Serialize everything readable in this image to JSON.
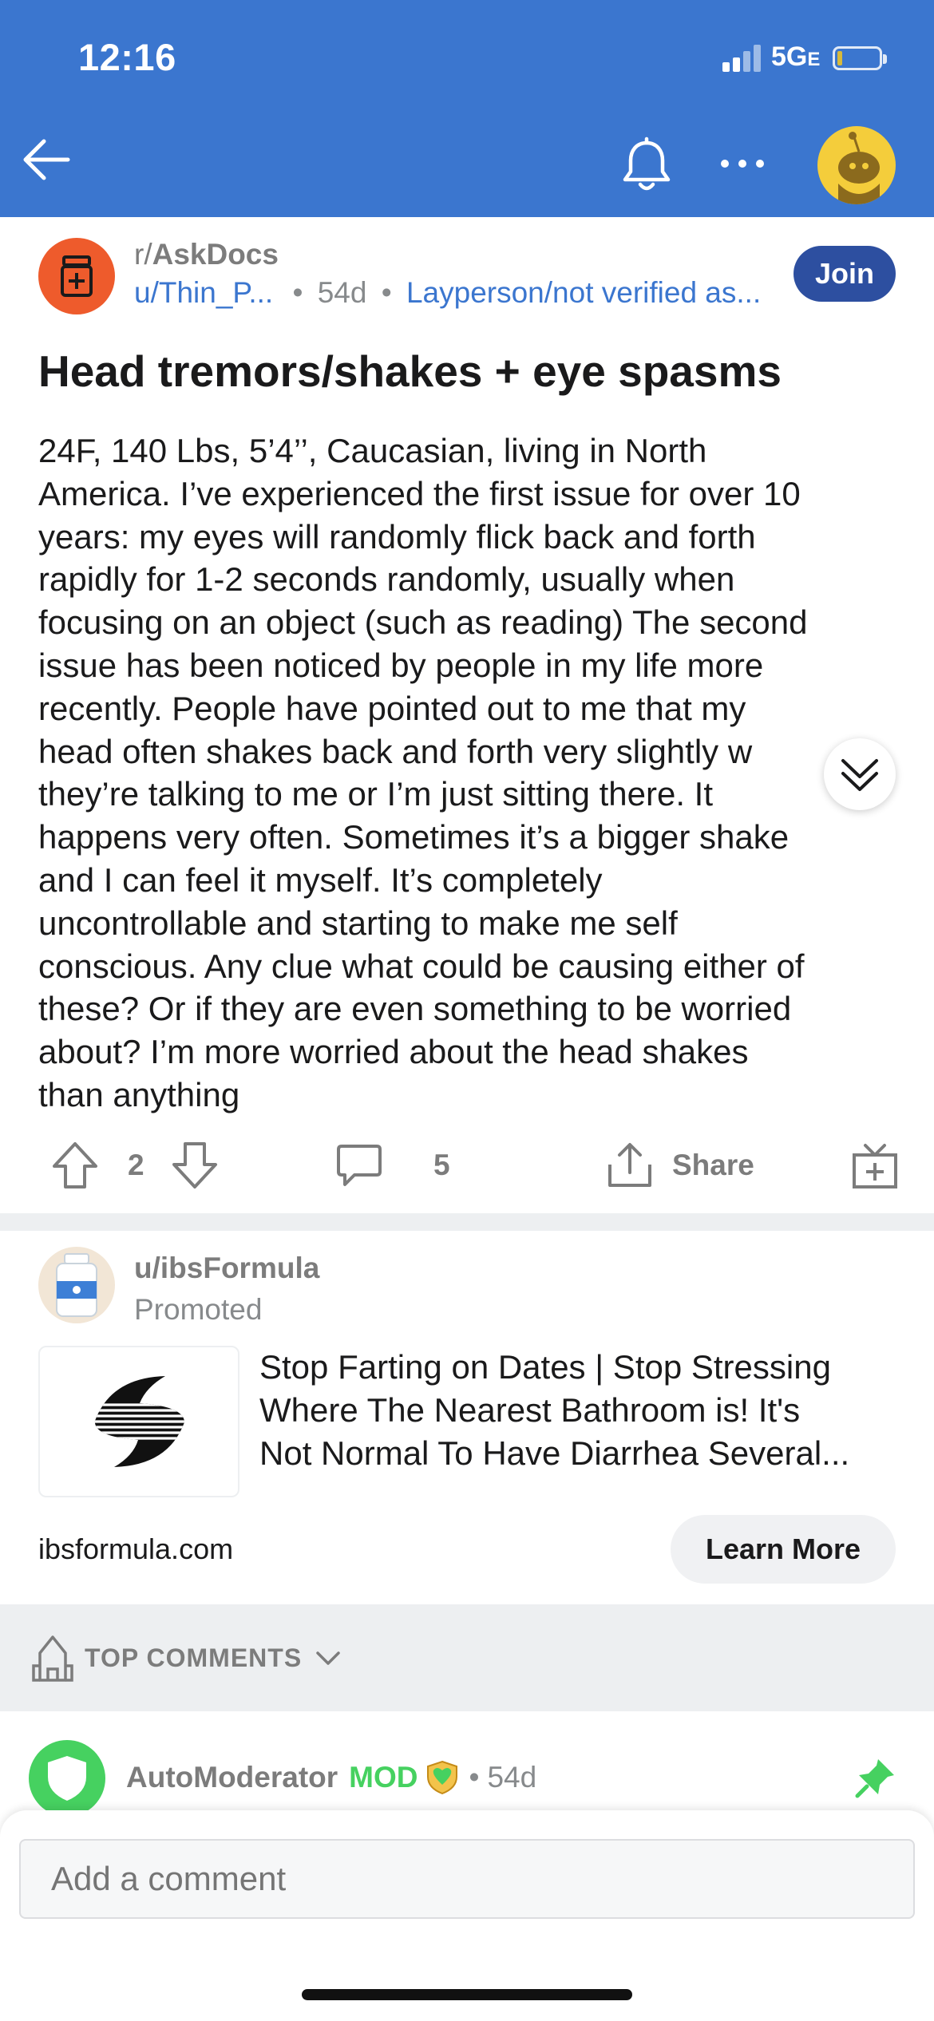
{
  "status_bar": {
    "time": "12:16",
    "network": "5G",
    "network_suffix": "E"
  },
  "header": {
    "back_icon": "arrow-left-icon",
    "bell_icon": "bell-icon",
    "more_icon": "more-horizontal-icon",
    "avatar_icon": "snoo-avatar-icon"
  },
  "post": {
    "subreddit_prefix": "r/",
    "subreddit": "AskDocs",
    "author": "u/Thin_P...",
    "separator": "•",
    "age": "54d",
    "flair": "Layperson/not verified as...",
    "join_label": "Join",
    "title": "Head tremors/shakes + eye spasms",
    "body_lines": [
      "24F, 140 Lbs, 5’4’’, Caucasian, living in North",
      "America. I’ve experienced the first issue for over 10",
      "years: my eyes will randomly flick back and forth",
      "rapidly for 1-2 seconds randomly, usually when",
      "focusing on an object (such as reading) The second",
      "issue has been noticed by people in my life more",
      "recently. People have pointed out to me that my",
      "head often shakes back and forth very slightly w",
      "they’re talking to me or I’m just sitting there. It",
      "happens very often. Sometimes it’s a bigger shake",
      "and I can feel it myself. It’s completely",
      "uncontrollable and starting to make me self",
      "conscious. Any clue what could be causing either of",
      "these? Or if they are even something to be worried",
      "about? I’m more worried about the head shakes",
      "than anything"
    ],
    "vote_count": "2",
    "comment_count": "5",
    "share_label": "Share"
  },
  "promoted": {
    "user": "u/ibsFormula",
    "label": "Promoted",
    "text_lines": [
      "Stop Farting on Dates | Stop Stressing",
      "Where The Nearest Bathroom is! It's",
      "Not Normal To Have Diarrhea Several..."
    ],
    "domain": "ibsformula.com",
    "cta_label": "Learn More"
  },
  "comments": {
    "sort_label": "TOP COMMENTS",
    "first": {
      "author": "AutoModerator",
      "mod_tag": "MOD",
      "separator": "•",
      "age": "54d"
    },
    "input_placeholder": "Add a comment"
  },
  "colors": {
    "header_blue": "#3b76cf",
    "join_blue": "#2d4fa0",
    "subreddit_orange": "#ee5b2c",
    "mod_green": "#46d160"
  }
}
